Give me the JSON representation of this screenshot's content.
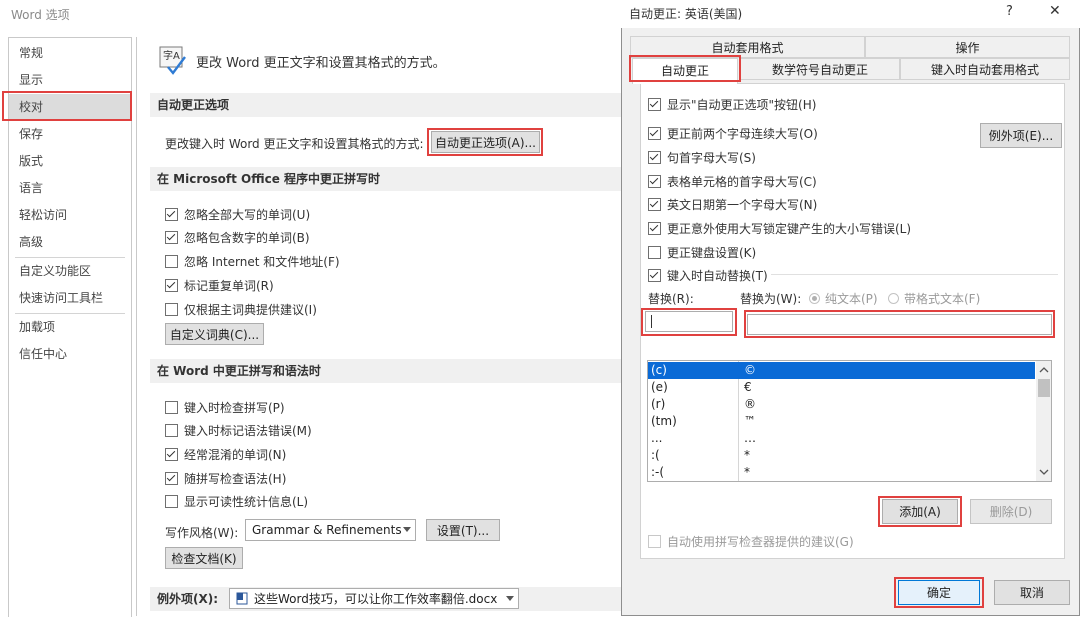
{
  "opt": {
    "title": "Word 选项",
    "nav": [
      "常规",
      "显示",
      "校对",
      "保存",
      "版式",
      "语言",
      "轻松访问",
      "高级",
      "自定义功能区",
      "快速访问工具栏",
      "加载项",
      "信任中心"
    ],
    "header": "更改 Word 更正文字和设置其格式的方式。",
    "sec1": "自动更正选项",
    "sec1_label": "更改键入时 Word 更正文字和设置其格式的方式:",
    "sec1_btn": "自动更正选项(A)...",
    "sec2": "在 Microsoft Office 程序中更正拼写时",
    "sec2_items": [
      "忽略全部大写的单词(U)",
      "忽略包含数字的单词(B)",
      "忽略 Internet 和文件地址(F)",
      "标记重复单词(R)",
      "仅根据主词典提供建议(I)"
    ],
    "sec2_btn": "自定义词典(C)...",
    "sec3": "在 Word 中更正拼写和语法时",
    "sec3_items": [
      "键入时检查拼写(P)",
      "键入时标记语法错误(M)",
      "经常混淆的单词(N)",
      "随拼写检查语法(H)",
      "显示可读性统计信息(L)"
    ],
    "style_label": "写作风格(W):",
    "style_value": "Grammar & Refinements",
    "settings_btn": "设置(T)...",
    "check_btn": "检查文档(K)",
    "except_label": "例外项(X):",
    "except_value": "这些Word技巧，可以让你工作效率翻倍.docx"
  },
  "ac": {
    "title": "自动更正: 英语(美国)",
    "help": "?",
    "close": "✕",
    "tabs_top": [
      "自动套用格式",
      "操作"
    ],
    "tabs_bottom": [
      "自动更正",
      "数学符号自动更正",
      "键入时自动套用格式"
    ],
    "show_btn": "显示\"自动更正选项\"按钮(H)",
    "items": [
      "更正前两个字母连续大写(O)",
      "句首字母大写(S)",
      "表格单元格的首字母大写(C)",
      "英文日期第一个字母大写(N)",
      "更正意外使用大写锁定键产生的大小写错误(L)",
      "更正键盘设置(K)"
    ],
    "exceptions_btn": "例外项(E)...",
    "replace_check": "键入时自动替换(T)",
    "replace_label": "替换(R):",
    "with_label": "替换为(W):",
    "plain": "纯文本(P)",
    "formatted": "带格式文本(F)",
    "rows": [
      [
        "(c)",
        "©"
      ],
      [
        "(e)",
        "€"
      ],
      [
        "(r)",
        "®"
      ],
      [
        "(tm)",
        "™"
      ],
      [
        "...",
        "…"
      ],
      [
        ":(",
        "*"
      ],
      [
        ":-(",
        "*"
      ]
    ],
    "add_btn": "添加(A)",
    "del_btn": "删除(D)",
    "suggest": "自动使用拼写检查器提供的建议(G)",
    "ok": "确定",
    "cancel": "取消"
  }
}
